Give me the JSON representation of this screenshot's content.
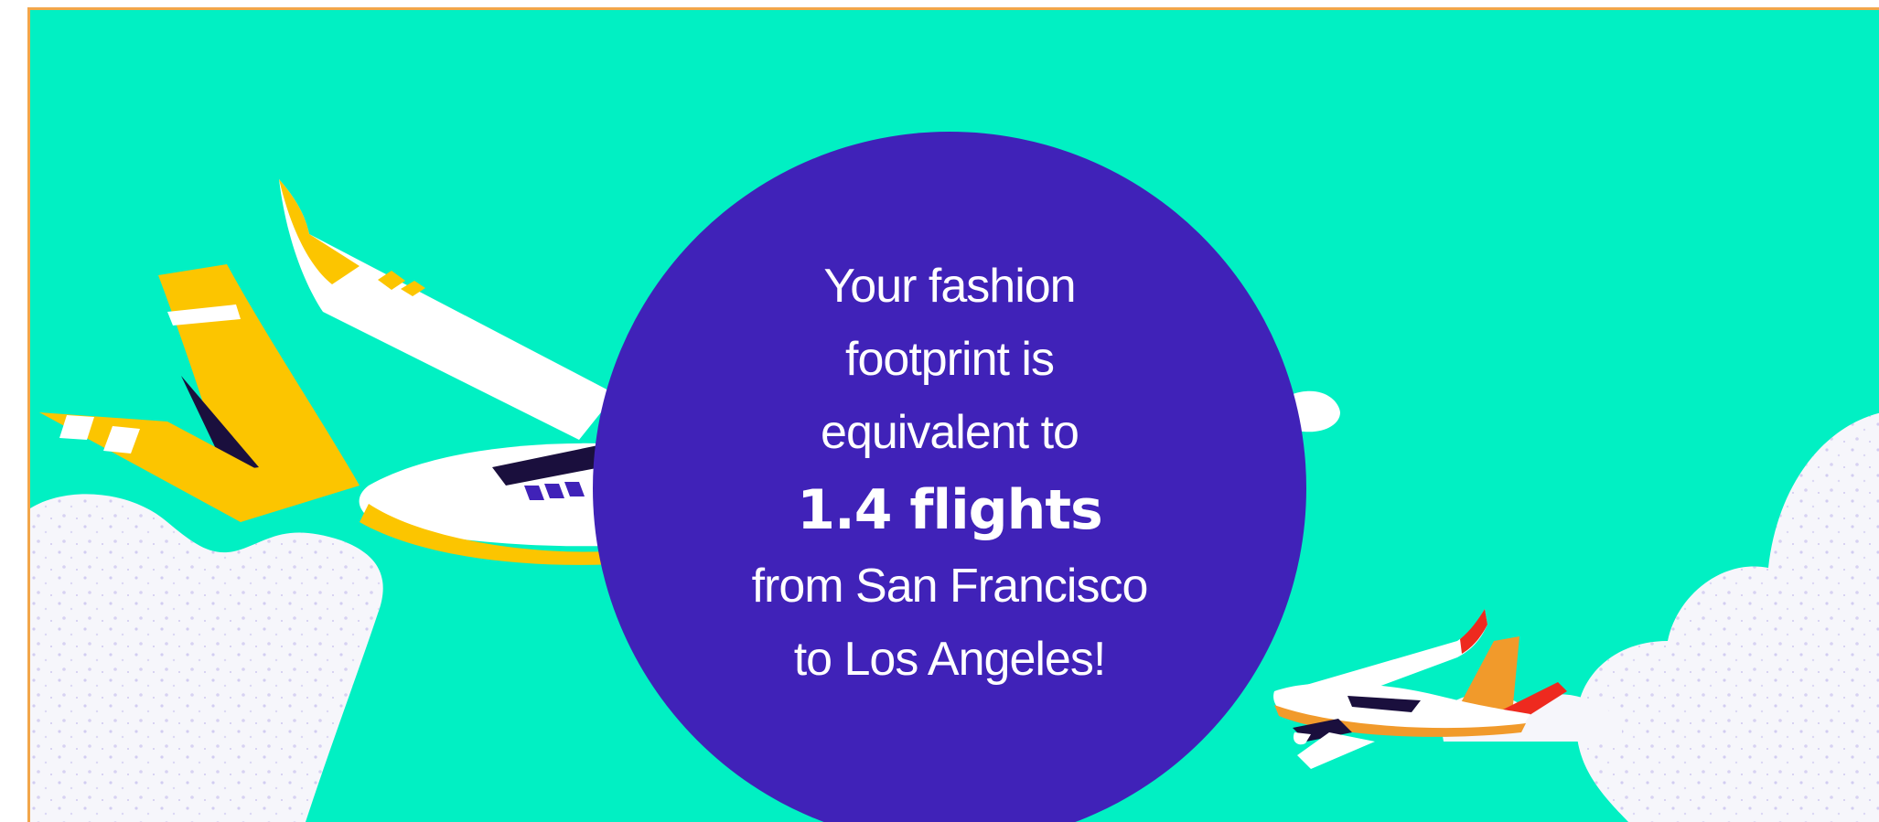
{
  "colors": {
    "background": "#01f0c3",
    "circle": "#4022b8",
    "text": "#ffffff",
    "plane_yellow": "#fcc500",
    "plane_orange": "#f19a2b",
    "plane_red": "#ee2a1f",
    "cloud": "#f6f6fb",
    "frame_border": "#f2a64a"
  },
  "illustration": {
    "large_plane_icon": "airplane-icon",
    "small_plane_icon": "airplane-icon",
    "clouds_icon": "cloud-icon"
  },
  "result": {
    "line1": "Your fashion",
    "line2": "footprint is",
    "line3": "equivalent to",
    "highlight": "1.4 flights",
    "line4": "from San Francisco",
    "line5": "to Los Angeles!"
  }
}
